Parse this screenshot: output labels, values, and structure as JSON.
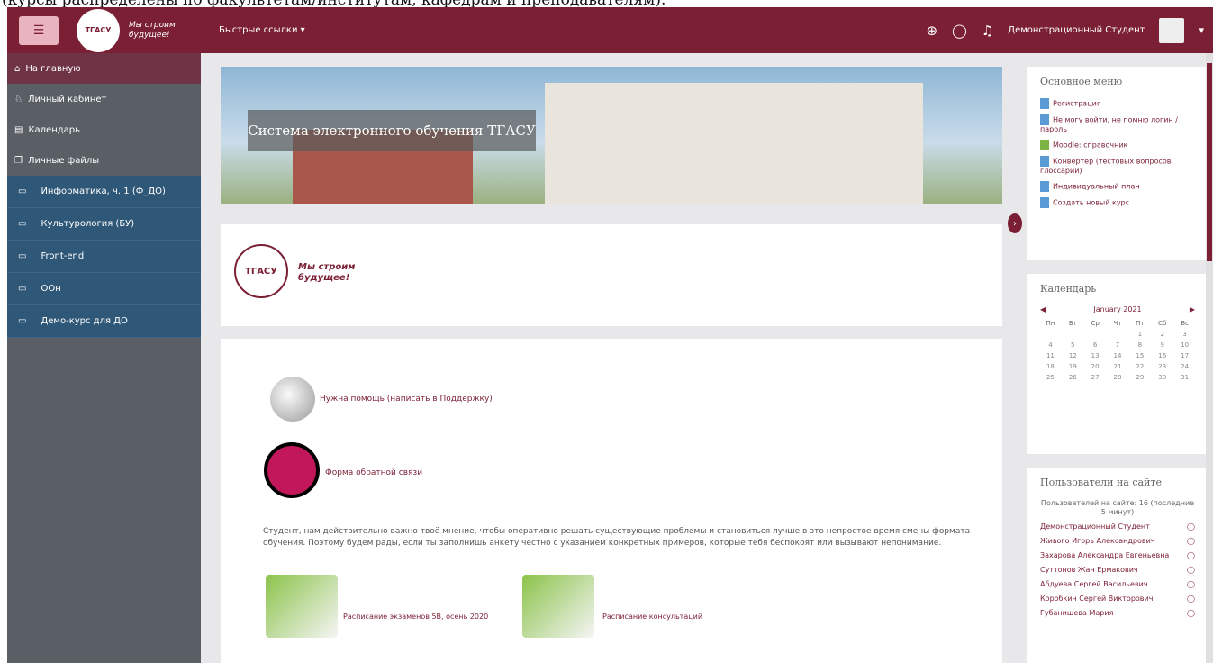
{
  "top_caption": "(курсы распределены по факультетам/институтам, кафедрам и преподавателям).",
  "header": {
    "logo_text": "ТГАСУ",
    "slogan": "Мы строим будущее!",
    "quick_links": "Быстрые ссылки ▾",
    "user_name": "Демонстрационный Студент",
    "dropdown": "▾"
  },
  "sidebar": {
    "items": [
      {
        "label": "На главную",
        "icon": "⌂"
      },
      {
        "label": "Личный кабинет",
        "icon": "♘"
      },
      {
        "label": "Календарь",
        "icon": "▤"
      },
      {
        "label": "Личные файлы",
        "icon": "❐"
      }
    ],
    "courses": [
      {
        "label": "Информатика, ч. 1 (Ф_ДО)"
      },
      {
        "label": "Культурология (БУ)"
      },
      {
        "label": "Front-end"
      },
      {
        "label": "ООн"
      },
      {
        "label": "Демо-курс для ДО"
      }
    ]
  },
  "main": {
    "banner_caption": "Система электронного обучения ТГАСУ",
    "card_slogan": "Мы строим будущее!",
    "help_link": "Нужна помощь (написать в Поддержку)",
    "feedback_link": "Форма обратной связи",
    "paragraph": "Студент, нам действительно важно твоё мнение, чтобы оперативно решать существующие проблемы и становиться лучше в это непростое время смены формата обучения. Поэтому будем рады, если ты заполнишь анкету честно с указанием конкретных примеров, которые тебя беспокоят или вызывают непонимание.",
    "schedule1": "Расписание экзаменов 5В, осень 2020",
    "schedule2": "Расписание консультаций"
  },
  "blocks": {
    "menu": {
      "title": "Основное меню",
      "items": [
        "Регистрация",
        "Не могу войти, не помню логин / пароль",
        "Moodle: справочник",
        "Конвертер (тестовых вопросов, глоссарий)",
        "Индивидуальный план",
        "Создать новый курс"
      ]
    },
    "calendar": {
      "title": "Календарь",
      "month": "January 2021",
      "days": [
        "Пн",
        "Вт",
        "Ср",
        "Чт",
        "Пт",
        "Сб",
        "Вс"
      ],
      "dates": [
        "",
        "",
        "",
        "",
        "1",
        "2",
        "3",
        "4",
        "5",
        "6",
        "7",
        "8",
        "9",
        "10",
        "11",
        "12",
        "13",
        "14",
        "15",
        "16",
        "17",
        "18",
        "19",
        "20",
        "21",
        "22",
        "23",
        "24",
        "25",
        "26",
        "27",
        "28",
        "29",
        "30",
        "31"
      ]
    },
    "users": {
      "title": "Пользователи на сайте",
      "summary": "Пользователей на сайте: 16 (последние 5 минут)",
      "list": [
        "Демонстрационный Студент",
        "Живого Игорь Александрович",
        "Захарова Александра Евгеньевна",
        "Суттонов Жан Ермакович",
        "Абдуева Сергей Васильевич",
        "Коробкин Сергей Викторович",
        "Губанищева Мария"
      ]
    }
  }
}
